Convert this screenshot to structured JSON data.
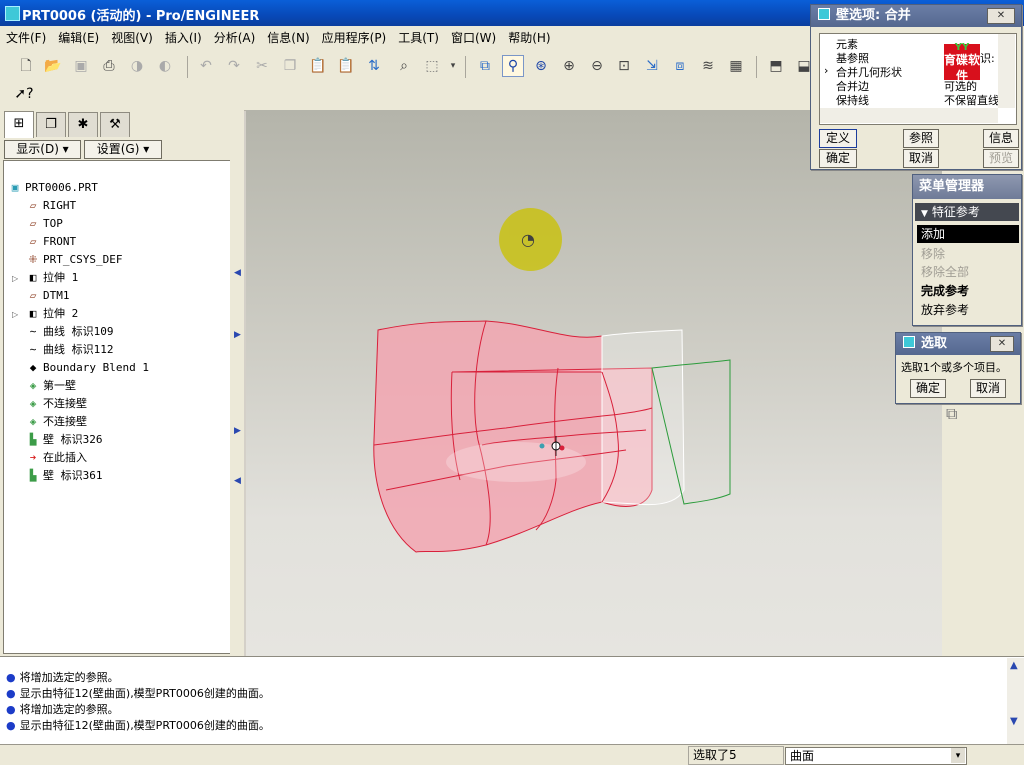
{
  "window": {
    "title": "PRT0006 (活动的) - Pro/ENGINEER"
  },
  "menubar": [
    "文件(F)",
    "编辑(E)",
    "视图(V)",
    "插入(I)",
    "分析(A)",
    "信息(N)",
    "应用程序(P)",
    "工具(T)",
    "窗口(W)",
    "帮助(H)"
  ],
  "panel": {
    "show_button": "显示(D) ▾",
    "settings_button": "设置(G) ▾",
    "tree": [
      {
        "label": "PRT0006.PRT",
        "icon": "part-icon"
      },
      {
        "label": "RIGHT",
        "icon": "datum-plane-icon"
      },
      {
        "label": "TOP",
        "icon": "datum-plane-icon"
      },
      {
        "label": "FRONT",
        "icon": "datum-plane-icon"
      },
      {
        "label": "PRT_CSYS_DEF",
        "icon": "csys-icon"
      },
      {
        "label": "拉伸 1",
        "icon": "extrude-icon"
      },
      {
        "label": "DTM1",
        "icon": "datum-plane-icon"
      },
      {
        "label": "拉伸 2",
        "icon": "extrude-icon"
      },
      {
        "label": "曲线 标识109",
        "icon": "curve-icon"
      },
      {
        "label": "曲线 标识112",
        "icon": "curve-icon"
      },
      {
        "label": "Boundary Blend 1",
        "icon": "blend-icon"
      },
      {
        "label": "第一壁",
        "icon": "wall-icon"
      },
      {
        "label": "不连接壁",
        "icon": "wall-icon"
      },
      {
        "label": "不连接壁",
        "icon": "wall-icon"
      },
      {
        "label": "壁 标识326",
        "icon": "wall-icon"
      },
      {
        "label": "在此插入",
        "icon": "insert-arrow-icon"
      },
      {
        "label": "壁 标识361",
        "icon": "wall-icon"
      }
    ]
  },
  "wall_dialog": {
    "title": "壁选项: 合并",
    "rows": [
      {
        "name": "元素",
        "value": ""
      },
      {
        "name": "基参照",
        "value": "识:"
      },
      {
        "name": "合并几何形状",
        "value": ""
      },
      {
        "name": "合并边",
        "value": "可选的"
      },
      {
        "name": "保持线",
        "value": "不保留直线"
      }
    ],
    "watermark": "育碟软件",
    "buttons": {
      "define": "定义",
      "reference": "参照",
      "info": "信息",
      "ok": "确定",
      "cancel": "取消",
      "preview": "预览"
    }
  },
  "menu_manager": {
    "title": "菜单管理器",
    "section": "特征参考",
    "items": [
      {
        "label": "添加",
        "state": "selected"
      },
      {
        "label": "移除",
        "state": "disabled"
      },
      {
        "label": "移除全部",
        "state": "disabled"
      },
      {
        "label": "完成参考",
        "state": "bold"
      },
      {
        "label": "放弃参考",
        "state": "normal"
      }
    ]
  },
  "select_dialog": {
    "title": "选取",
    "prompt": "选取1个或多个项目。",
    "ok": "确定",
    "cancel": "取消"
  },
  "messages": [
    "将增加选定的参照。",
    "显示由特征12(壁曲面),模型PRT0006创建的曲面。",
    "将增加选定的参照。",
    "显示由特征12(壁曲面),模型PRT0006创建的曲面。"
  ],
  "status": {
    "selected": "选取了5",
    "filter": "曲面"
  },
  "colors": {
    "surface": "#f0a8b4",
    "edge": "#d8203a",
    "green_edge": "#2c9c3c"
  }
}
